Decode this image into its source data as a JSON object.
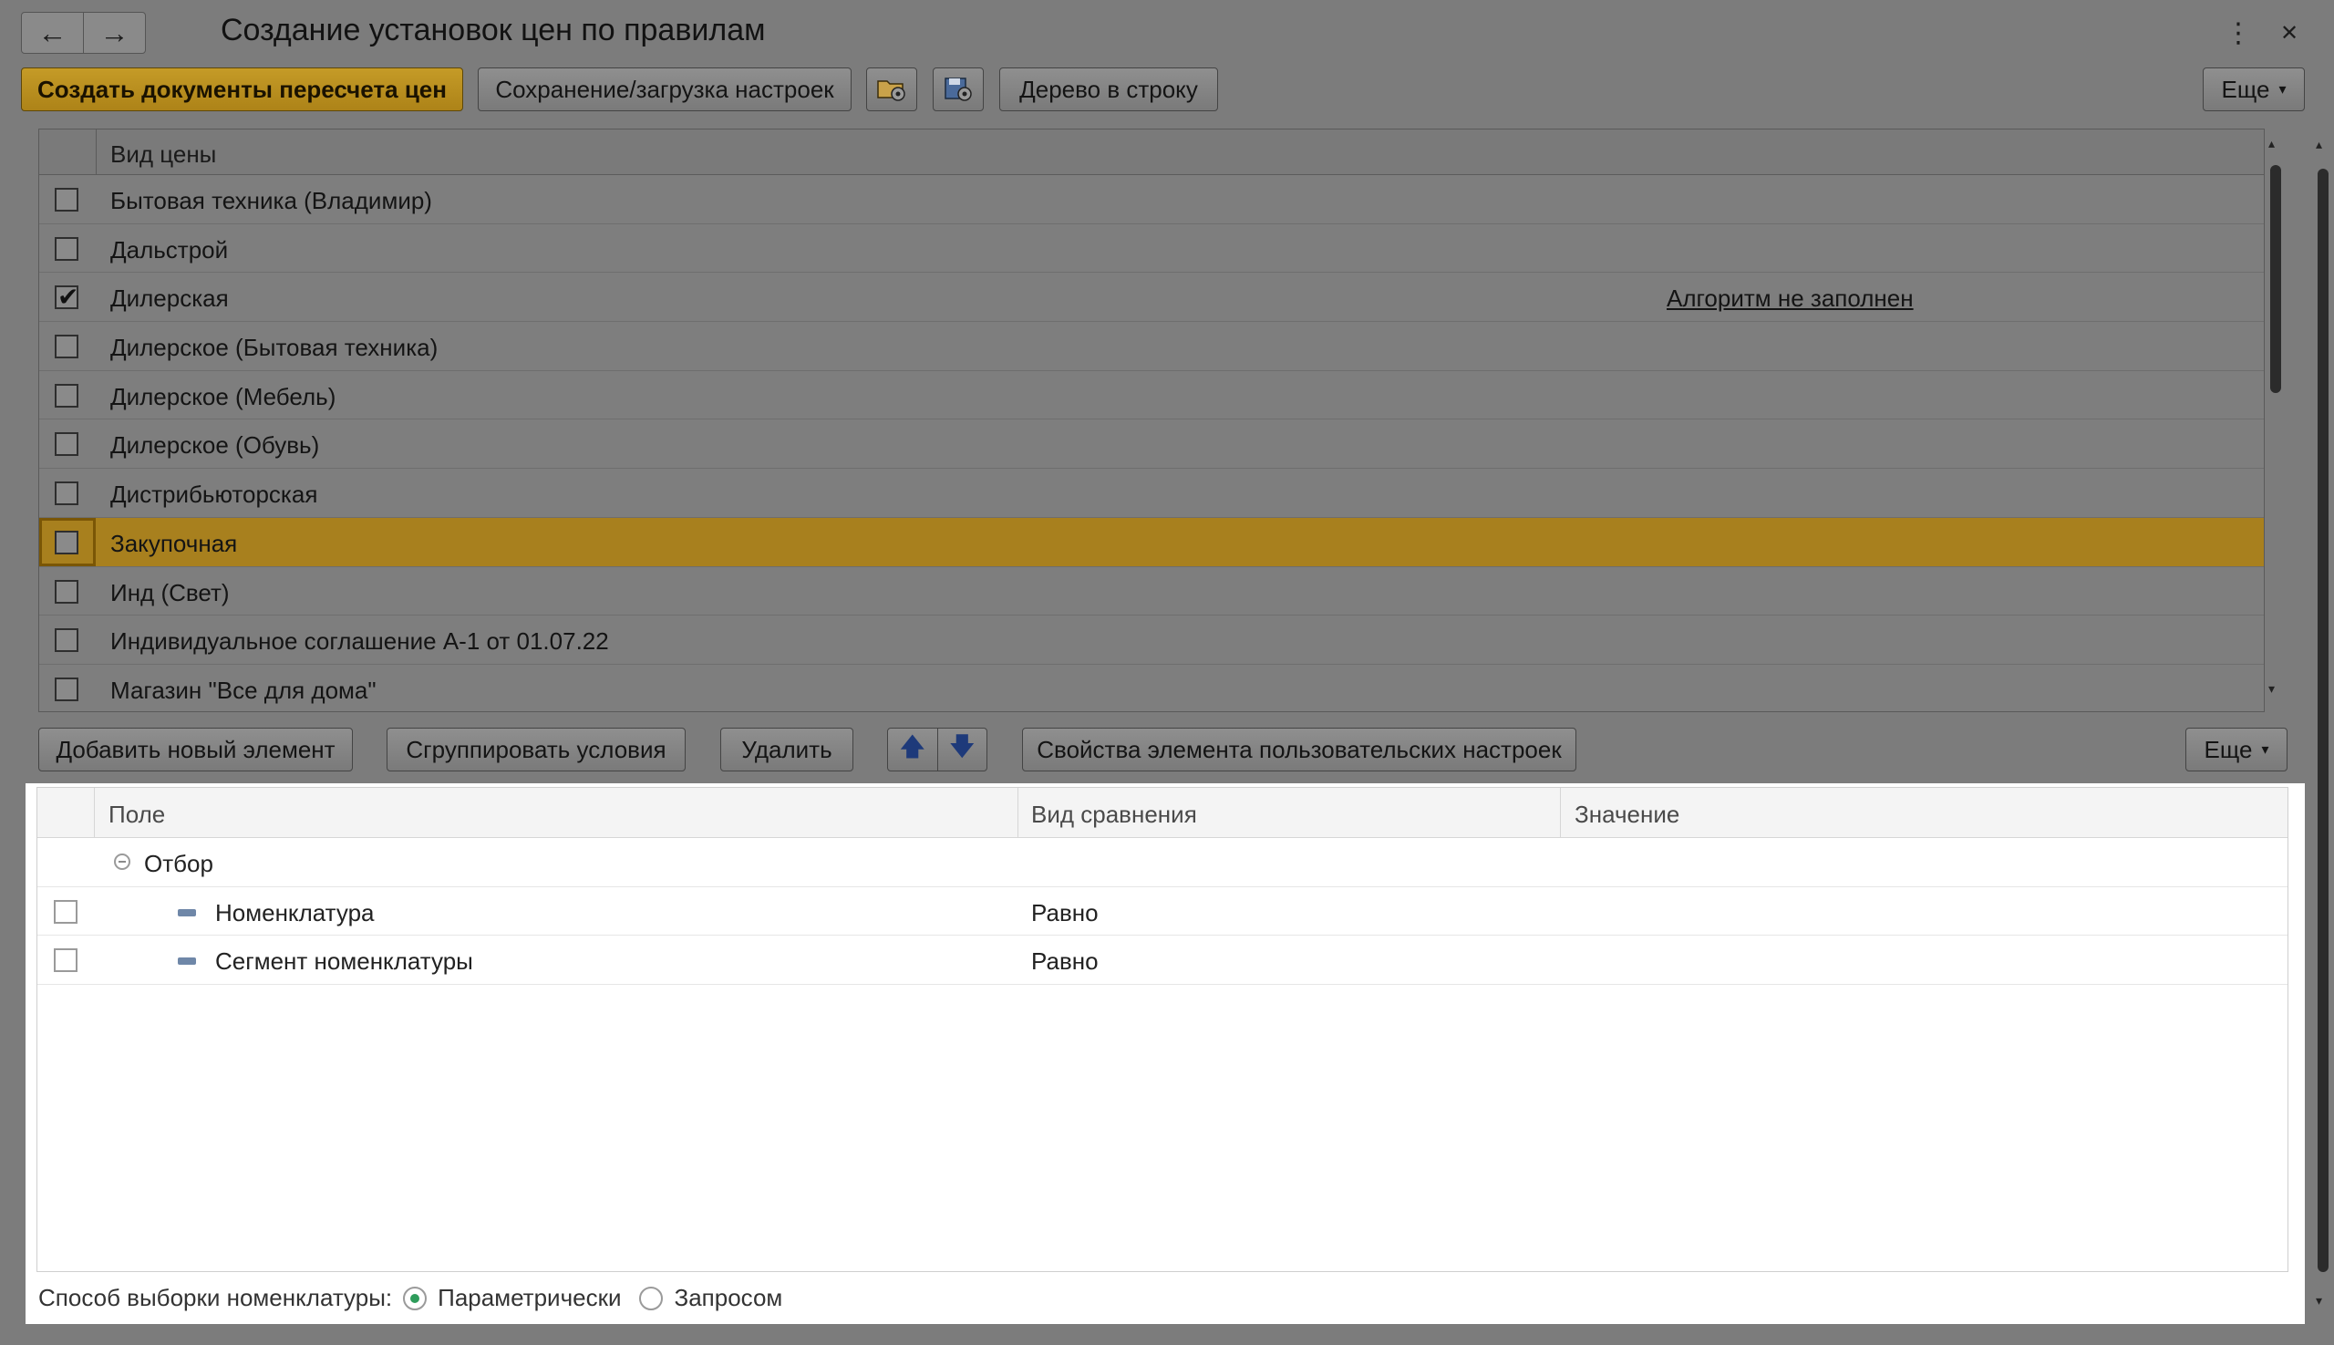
{
  "window": {
    "title": "Создание установок цен по правилам",
    "back_icon": "←",
    "forward_icon": "→",
    "menu_icon": "⋮",
    "close_icon": "✕"
  },
  "toolbar": {
    "create_docs_label": "Создать документы пересчета цен",
    "save_load_label": "Сохранение/загрузка настроек",
    "tree_to_row_label": "Дерево в строку",
    "more_label": "Еще"
  },
  "price_types": {
    "column_header": "Вид цены",
    "rows": [
      {
        "label": "Бытовая техника (Владимир)",
        "checked": false
      },
      {
        "label": "Дальстрой",
        "checked": false
      },
      {
        "label": "Дилерская",
        "checked": true,
        "note": "Алгоритм не заполнен"
      },
      {
        "label": "Дилерское (Бытовая техника)",
        "checked": false
      },
      {
        "label": "Дилерское (Мебель)",
        "checked": false
      },
      {
        "label": "Дилерское (Обувь)",
        "checked": false
      },
      {
        "label": "Дистрибьюторская",
        "checked": false
      },
      {
        "label": "Закупочная",
        "checked": false,
        "selected": true
      },
      {
        "label": "Инд (Свет)",
        "checked": false
      },
      {
        "label": "Индивидуальное соглашение А-1 от 01.07.22",
        "checked": false
      },
      {
        "label": "Магазин \"Все для дома\"",
        "checked": false
      }
    ]
  },
  "filter_toolbar": {
    "add_label": "Добавить новый элемент",
    "group_label": "Сгруппировать условия",
    "delete_label": "Удалить",
    "up_icon": "🡅",
    "down_icon": "🡇",
    "properties_label": "Свойства элемента пользовательских настроек",
    "more_label": "Еще"
  },
  "filter_grid": {
    "headers": {
      "field": "Поле",
      "comparison": "Вид сравнения",
      "value": "Значение"
    },
    "group_label": "Отбор",
    "rows": [
      {
        "field": "Номенклатура",
        "comparison": "Равно"
      },
      {
        "field": "Сегмент номенклатуры",
        "comparison": "Равно"
      }
    ]
  },
  "selection_method": {
    "label": "Способ выборки номенклатуры:",
    "options": [
      "Параметрически",
      "Запросом"
    ],
    "selected": "Параметрически"
  }
}
